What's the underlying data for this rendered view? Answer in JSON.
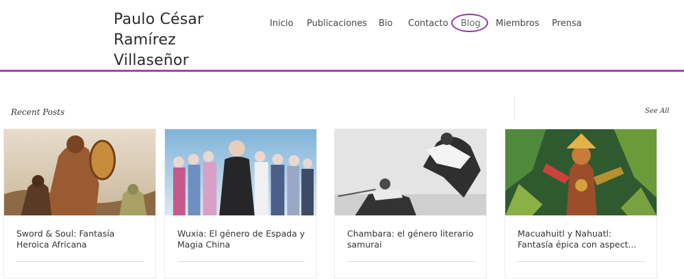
{
  "site": {
    "title_lines": [
      "Paulo César",
      "Ramírez",
      "Villaseñor"
    ]
  },
  "nav": {
    "items": [
      "Inicio",
      "Publicaciones",
      "Bio",
      "Contacto",
      "Blog",
      "Miembros",
      "Prensa"
    ],
    "active": "Blog"
  },
  "recent_posts": {
    "heading": "Recent Posts",
    "see_all": "See All",
    "posts": [
      {
        "title": "Sword & Soul: Fantasía Heroica Africana"
      },
      {
        "title": "Wuxia: El género de Espada y Magia China"
      },
      {
        "title": "Chambara: el género literario samurai"
      },
      {
        "title": "Macuahuitl y Nahuatl: Fantasía épica con aspect..."
      }
    ]
  },
  "colors": {
    "accent": "#a63fb1",
    "active_ring": "#8e3a9e"
  }
}
